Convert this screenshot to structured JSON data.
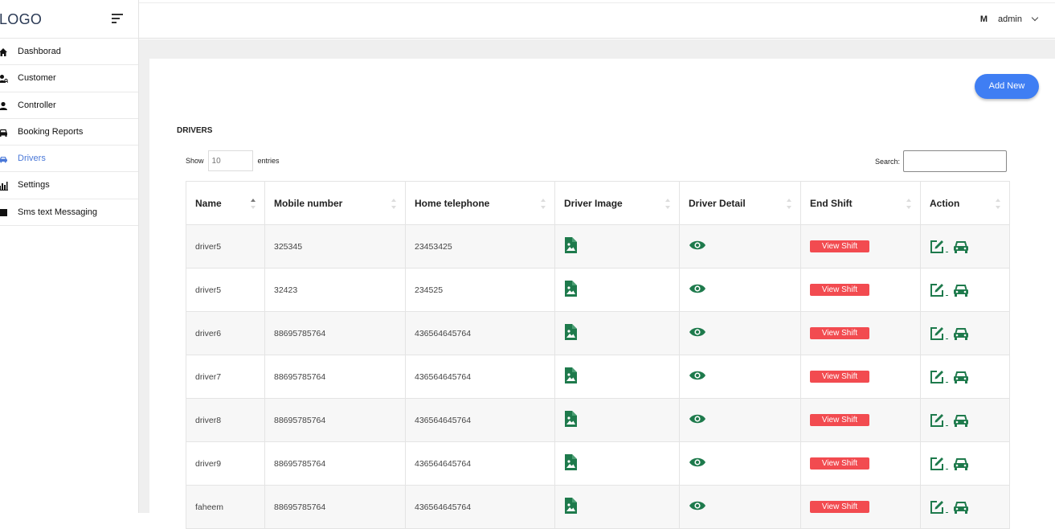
{
  "brand": {
    "logo_text": "LOGO"
  },
  "sidebar": {
    "items": [
      {
        "label": "Dashborad",
        "icon": "home-icon"
      },
      {
        "label": "Customer",
        "icon": "user-search-icon"
      },
      {
        "label": "Controller",
        "icon": "user-icon"
      },
      {
        "label": "Booking Reports",
        "icon": "car-icon"
      },
      {
        "label": "Drivers",
        "icon": "car-icon",
        "active": true
      },
      {
        "label": "Settings",
        "icon": "chart-icon"
      },
      {
        "label": "Sms text Messaging",
        "icon": "square-icon"
      }
    ]
  },
  "topbar": {
    "user_badge": "M",
    "user_name": "admin"
  },
  "main": {
    "add_button": "Add New",
    "title": "DRIVERS",
    "show_label": "Show",
    "entries_placeholder": "10",
    "entries_label": "entries",
    "search_label": "Search:",
    "columns": [
      "Name",
      "Mobile number",
      "Home telephone",
      "Driver Image",
      "Driver Detail",
      "End Shift",
      "Action"
    ],
    "view_shift_label": "View Shift",
    "rows": [
      {
        "name": "driver5",
        "mobile": "325345",
        "home": "23453425"
      },
      {
        "name": "driver5",
        "mobile": "32423",
        "home": "234525"
      },
      {
        "name": "driver6",
        "mobile": "88695785764",
        "home": "436564645764"
      },
      {
        "name": "driver7",
        "mobile": "88695785764",
        "home": "436564645764"
      },
      {
        "name": "driver8",
        "mobile": "88695785764",
        "home": "436564645764"
      },
      {
        "name": "driver9",
        "mobile": "88695785764",
        "home": "436564645764"
      },
      {
        "name": "faheem",
        "mobile": "88695785764",
        "home": "436564645764"
      }
    ]
  },
  "colors": {
    "accent": "#3f7ef3",
    "active_nav": "#4a78d8",
    "icon_green": "#1e7a4c",
    "danger": "#f24b50"
  }
}
